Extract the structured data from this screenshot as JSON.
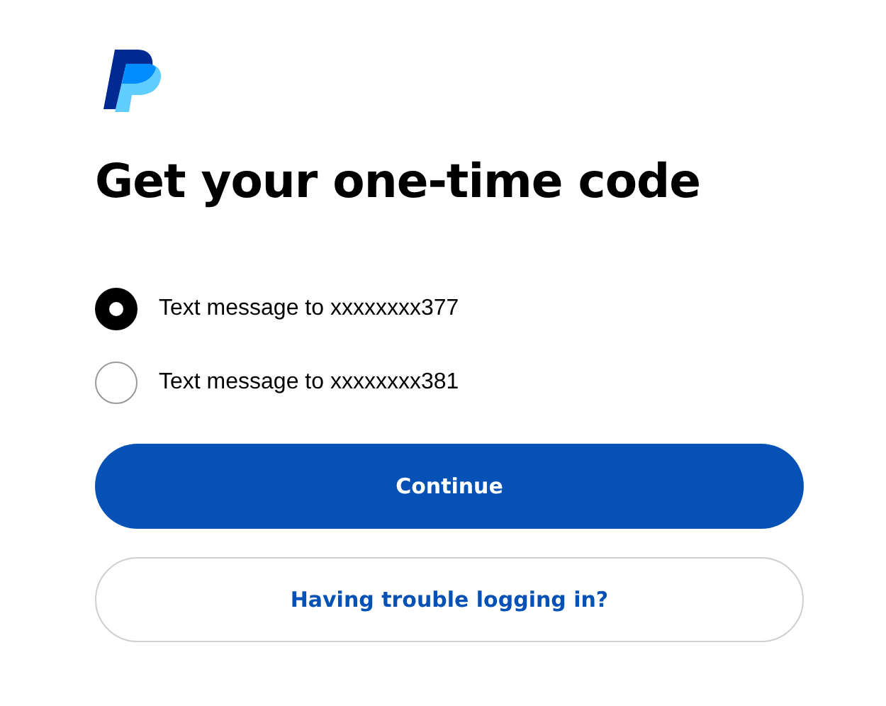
{
  "title": "Get your one-time code",
  "options": [
    {
      "label": "Text message to xxxxxxxx377",
      "selected": true
    },
    {
      "label": "Text message to xxxxxxxx381",
      "selected": false
    }
  ],
  "primary_button": "Continue",
  "secondary_button": "Having trouble logging in?"
}
